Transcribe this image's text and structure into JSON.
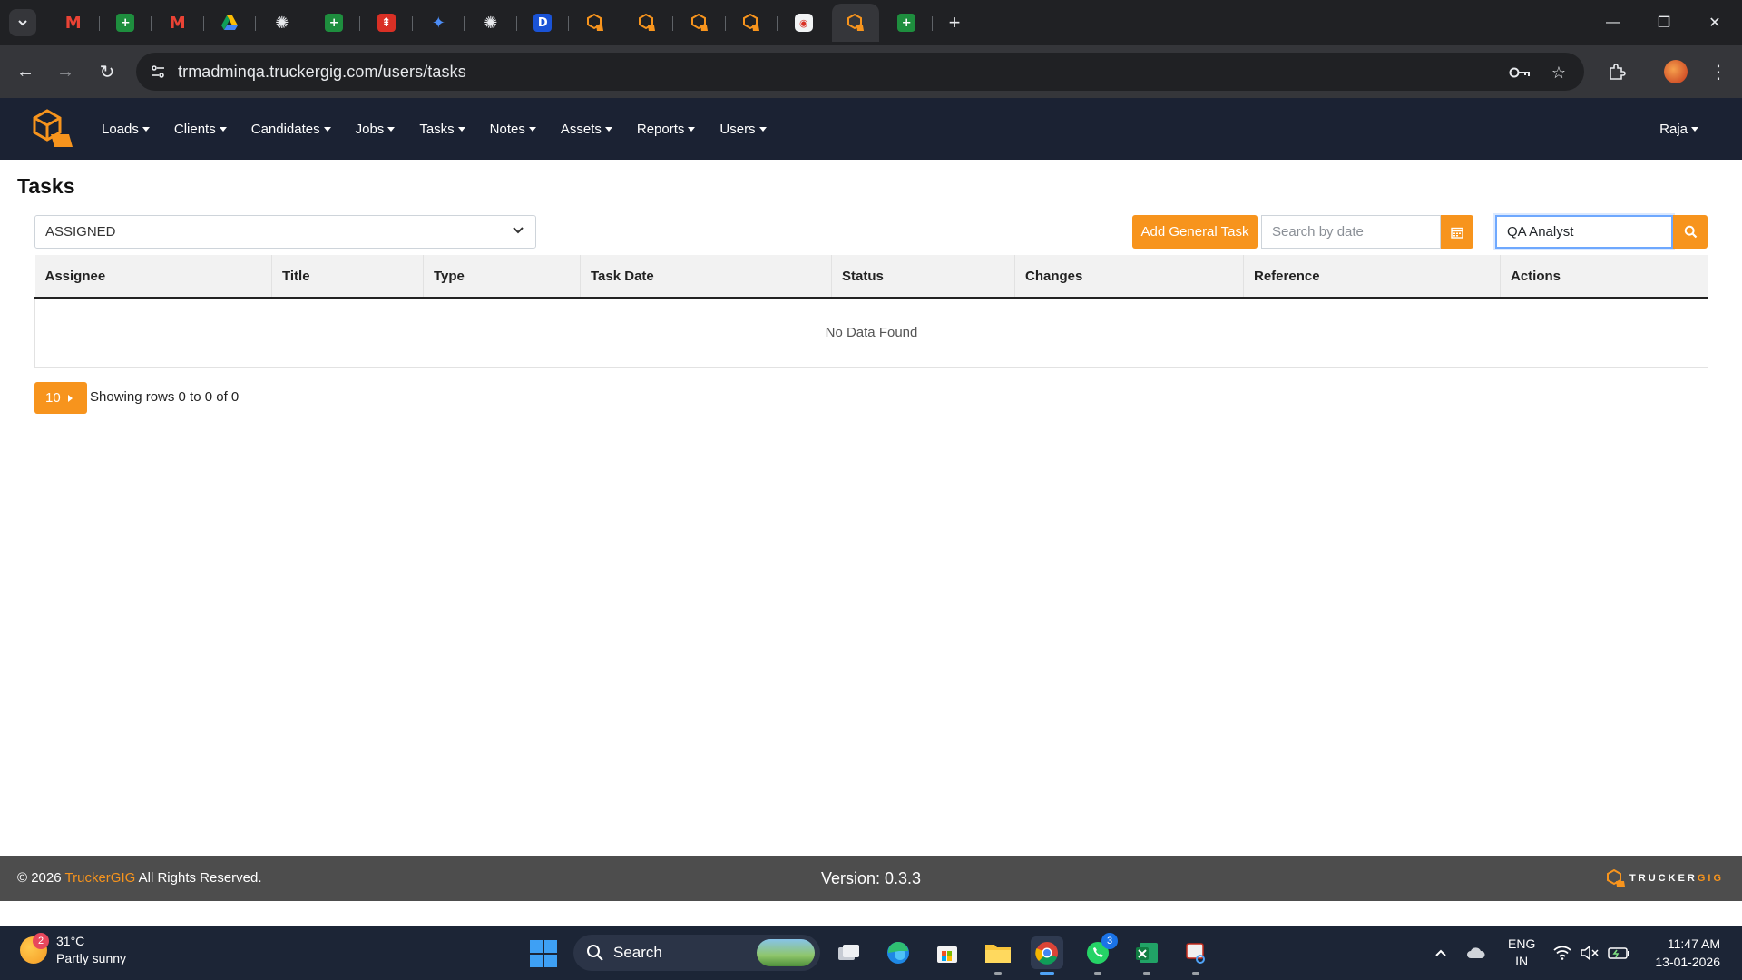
{
  "browser": {
    "url": "trmadminqa.truckergig.com/users/tasks",
    "tabs": [
      {
        "icon": "gmail-icon",
        "glyph": "M"
      },
      {
        "icon": "sheets-icon",
        "glyph": "+"
      },
      {
        "icon": "gmail-icon",
        "glyph": "M"
      },
      {
        "icon": "drive-icon",
        "glyph": ""
      },
      {
        "icon": "chatgpt-icon",
        "glyph": "✺"
      },
      {
        "icon": "sheets-icon",
        "glyph": "+"
      },
      {
        "icon": "app-red-icon",
        "glyph": "⇞"
      },
      {
        "icon": "gemini-icon",
        "glyph": "✦"
      },
      {
        "icon": "chatgpt-icon",
        "glyph": "✺"
      },
      {
        "icon": "dictionary-icon",
        "glyph": "D"
      },
      {
        "icon": "truckergig-icon",
        "glyph": ""
      },
      {
        "icon": "truckergig-icon",
        "glyph": ""
      },
      {
        "icon": "truckergig-icon",
        "glyph": ""
      },
      {
        "icon": "truckergig-icon",
        "glyph": ""
      },
      {
        "icon": "app-white-icon",
        "glyph": "◉"
      },
      {
        "icon": "truckergig-icon",
        "glyph": "",
        "active": true
      },
      {
        "icon": "sheets-icon",
        "glyph": "+"
      }
    ]
  },
  "nav": {
    "menu": [
      "Loads",
      "Clients",
      "Candidates",
      "Jobs",
      "Tasks",
      "Notes",
      "Assets",
      "Reports",
      "Users"
    ],
    "user": "Raja"
  },
  "page": {
    "title": "Tasks",
    "status_filter": "ASSIGNED",
    "add_button": "Add General Task",
    "date_placeholder": "Search by date",
    "search_value": "QA Analyst"
  },
  "table": {
    "columns": [
      "Assignee",
      "Title",
      "Type",
      "Task Date",
      "Status",
      "Changes",
      "Reference",
      "Actions"
    ],
    "empty_message": "No Data Found"
  },
  "pagination": {
    "page_size": "10",
    "info": "Showing rows 0 to 0 of 0"
  },
  "footer": {
    "copyright_prefix": "© 2026",
    "brand": "TruckerGIG",
    "copyright_suffix": "All Rights Reserved.",
    "version": "Version: 0.3.3",
    "logo_word_main": "TRUCKER",
    "logo_word_accent": "GIG"
  },
  "taskbar": {
    "weather_temp": "31°C",
    "weather_desc": "Partly sunny",
    "weather_badge": "2",
    "search_label": "Search",
    "whatsapp_badge": "3",
    "lang_1": "ENG",
    "lang_2": "IN",
    "time": "11:47 AM",
    "date": "13-01-2026"
  },
  "colors": {
    "accent": "#f7941d",
    "navbar": "#1b2233",
    "footer": "#4d4d4d"
  }
}
